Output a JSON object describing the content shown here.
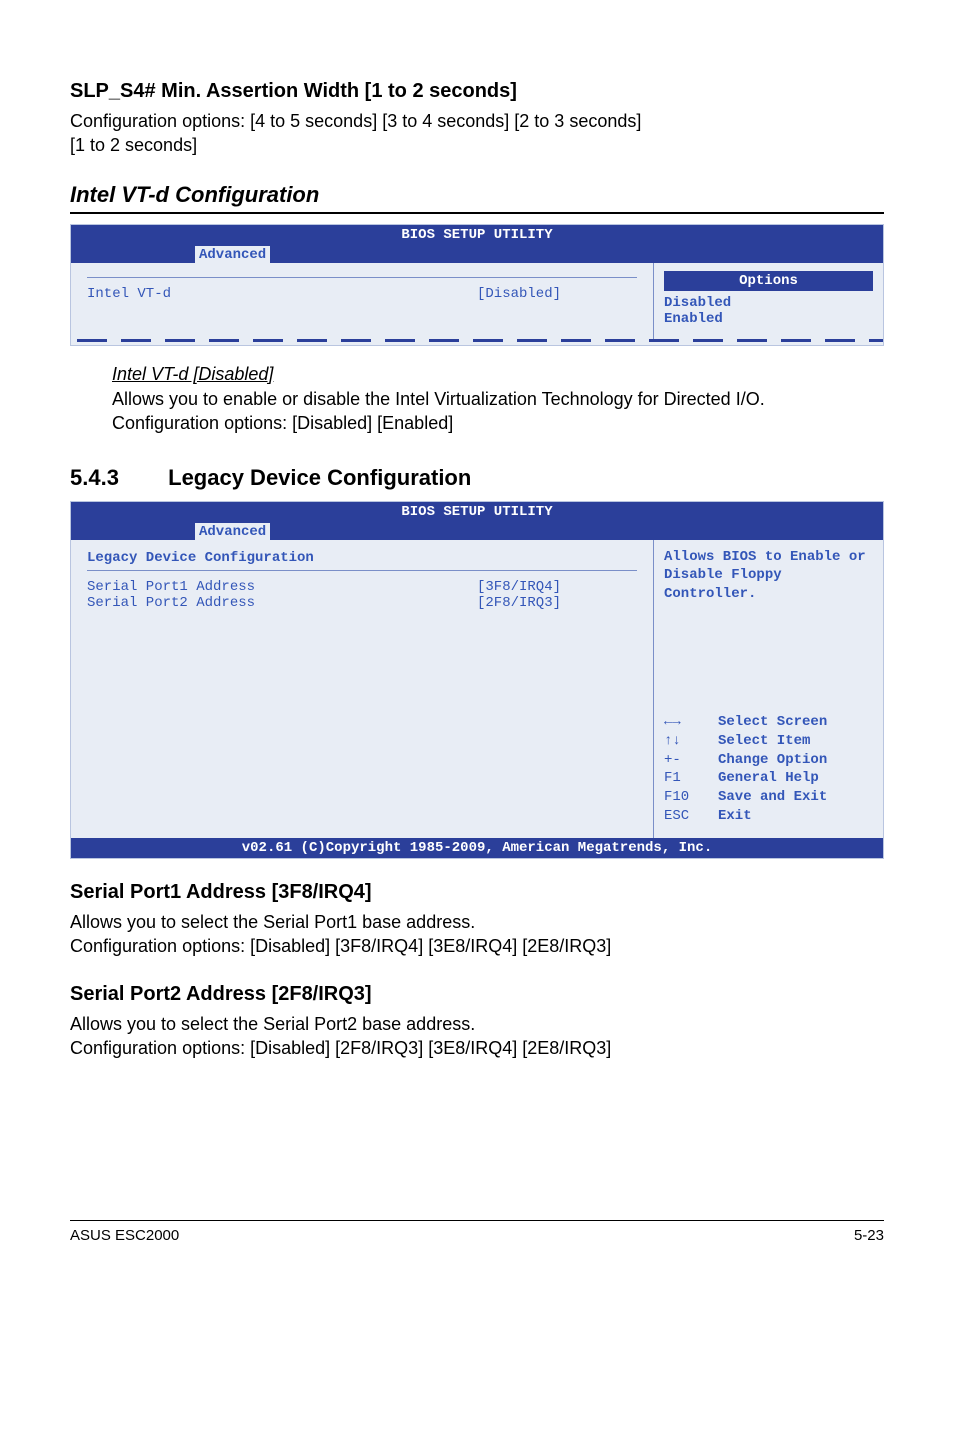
{
  "slp": {
    "heading": "SLP_S4# Min. Assertion Width [1 to 2 seconds]",
    "text1": "Configuration options: [4 to 5 seconds] [3 to 4 seconds] [2 to 3 seconds]",
    "text2": "[1 to 2 seconds]"
  },
  "vtd_section_title": "Intel VT-d Configuration",
  "bios_common": {
    "title": "BIOS SETUP UTILITY",
    "tab": "Advanced",
    "footer": "v02.61 (C)Copyright 1985-2009, American Megatrends, Inc."
  },
  "bios1": {
    "item_label": "Intel VT-d",
    "item_value": "[Disabled]",
    "options_title": "Options",
    "opt1": "Disabled",
    "opt2": "Enabled"
  },
  "vtd_detail": {
    "sub": "Intel VT-d [Disabled]",
    "line1": "Allows you to enable or disable the Intel Virtualization Technology for Directed I/O.",
    "line2": "Configuration options: [Disabled] [Enabled]"
  },
  "legacy_section": {
    "num": "5.4.3",
    "title": "Legacy Device Configuration"
  },
  "bios2": {
    "header": "Legacy Device Configuration",
    "row1_label": "Serial Port1 Address",
    "row1_value": "[3F8/IRQ4]",
    "row2_label": "Serial Port2 Address",
    "row2_value": "[2F8/IRQ3]",
    "help_text": "Allows BIOS to Enable or Disable Floppy Controller.",
    "nav": {
      "k1": "←→",
      "v1": "Select Screen",
      "k2": "↑↓",
      "v2": "Select Item",
      "k3": "+-",
      "v3": "Change Option",
      "k4": "F1",
      "v4": "General Help",
      "k5": "F10",
      "v5": "Save and Exit",
      "k6": "ESC",
      "v6": "Exit"
    }
  },
  "sp1": {
    "heading": "Serial Port1 Address [3F8/IRQ4]",
    "line1": "Allows you to select the Serial Port1 base address.",
    "line2": "Configuration options: [Disabled] [3F8/IRQ4] [3E8/IRQ4] [2E8/IRQ3]"
  },
  "sp2": {
    "heading": "Serial Port2 Address [2F8/IRQ3]",
    "line1": "Allows you to select the Serial Port2 base address.",
    "line2": "Configuration options: [Disabled] [2F8/IRQ3] [3E8/IRQ4] [2E8/IRQ3]"
  },
  "footer": {
    "left": "ASUS ESC2000",
    "right": "5-23"
  }
}
